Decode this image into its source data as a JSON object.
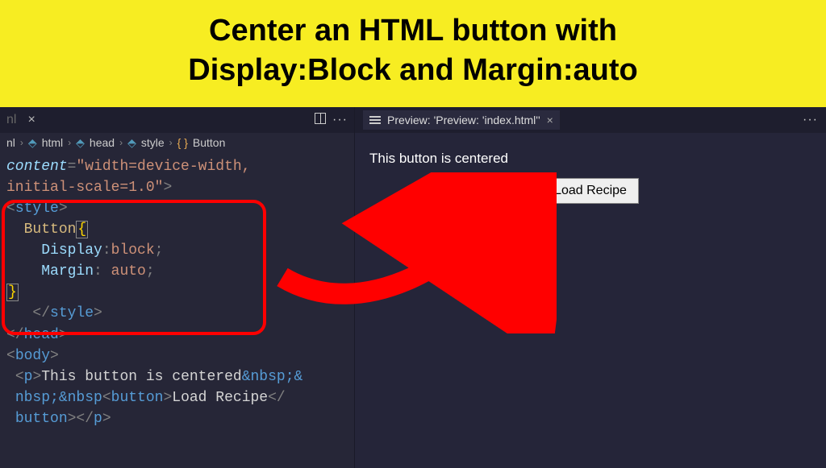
{
  "banner": {
    "line1": "Center an HTML button with",
    "line2": "Display:Block and Margin:auto"
  },
  "editor": {
    "tab_close": "×",
    "more": "···",
    "breadcrumb": {
      "seg0": "nl",
      "seg1": "html",
      "seg2": "head",
      "seg3": "style",
      "seg4": "Button"
    },
    "code": {
      "attr_content": "content",
      "attr_val1": "\"width=device-width,",
      "attr_val2": "initial-scale=1.0\"",
      "gt": ">",
      "style_open": "style",
      "selector": "Button",
      "brace_open": "{",
      "prop1": "Display",
      "val1": "block",
      "prop2": "Margin",
      "val2": " auto",
      "brace_close": "}",
      "style_close": "style",
      "head_close": "head",
      "body_open": "body",
      "p_open": "p",
      "para_text": "This button is centered",
      "nbsp": "&nbsp;",
      "amp": "&",
      "nbsp2": "nbsp;",
      "nbsp3": "&nbsp",
      "btn_open": "button",
      "btn_text": "Load Recipe",
      "btn_close": "button",
      "p_close": "p"
    }
  },
  "preview": {
    "tab_label": "Preview: 'Preview: 'index.html''",
    "tab_close": "×",
    "more": "···",
    "para": "This button is centered",
    "button": "Load Recipe"
  }
}
